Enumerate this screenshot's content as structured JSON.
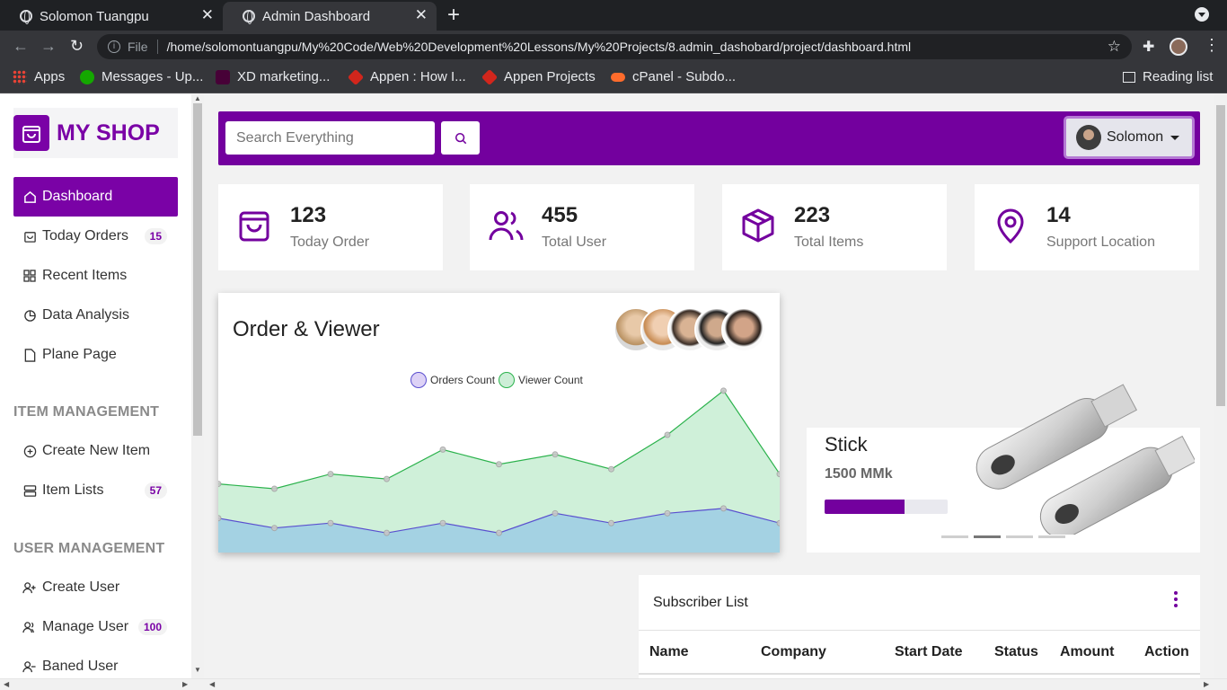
{
  "browser": {
    "tabs": [
      {
        "title": "Solomon Tuangpu"
      },
      {
        "title": "Admin Dashboard"
      }
    ],
    "address": {
      "scheme_label": "File",
      "url": "/home/solomontuangpu/My%20Code/Web%20Development%20Lessons/My%20Projects/8.admin_dashobard/project/dashboard.html"
    },
    "bookmarks": [
      {
        "label": "Apps"
      },
      {
        "label": "Messages - Up..."
      },
      {
        "label": "XD marketing..."
      },
      {
        "label": "Appen : How I..."
      },
      {
        "label": "Appen Projects"
      },
      {
        "label": "cPanel - Subdo..."
      }
    ],
    "reading_list": "Reading list"
  },
  "sidebar": {
    "brand": "MY SHOP",
    "items": [
      {
        "label": "Dashboard",
        "icon": "home-icon"
      },
      {
        "label": "Today Orders",
        "icon": "bag-icon",
        "badge": "15"
      },
      {
        "label": "Recent Items",
        "icon": "grid-icon"
      },
      {
        "label": "Data Analysis",
        "icon": "pie-icon"
      },
      {
        "label": "Plane Page",
        "icon": "file-icon"
      }
    ],
    "item_section": "ITEM MANAGEMENT",
    "item_items": [
      {
        "label": "Create New Item",
        "icon": "plus-circle-icon"
      },
      {
        "label": "Item Lists",
        "icon": "list-icon",
        "badge": "57"
      }
    ],
    "user_section": "USER MANAGEMENT",
    "user_items": [
      {
        "label": "Create User",
        "icon": "user-plus-icon"
      },
      {
        "label": "Manage User",
        "icon": "users-icon",
        "badge": "100"
      },
      {
        "label": "Baned User",
        "icon": "user-minus-icon"
      }
    ]
  },
  "header": {
    "search_placeholder": "Search Everything",
    "user_name": "Solomon"
  },
  "stats": [
    {
      "value": "123",
      "label": "Today Order",
      "icon": "bag-icon"
    },
    {
      "value": "455",
      "label": "Total User",
      "icon": "users-icon"
    },
    {
      "value": "223",
      "label": "Total Items",
      "icon": "box-icon"
    },
    {
      "value": "14",
      "label": "Support Location",
      "icon": "map-pin-icon"
    }
  ],
  "chart_card": {
    "title": "Order & Viewer"
  },
  "chart_data": {
    "type": "area",
    "x": [
      0,
      1,
      2,
      3,
      4,
      5,
      6,
      7,
      8,
      9,
      10
    ],
    "series": [
      {
        "name": "Orders Count",
        "values": [
          7,
          5,
          6,
          4,
          6,
          4,
          8,
          6,
          8,
          9,
          6
        ],
        "color": "#5a4fcf"
      },
      {
        "name": "Viewer Count",
        "values": [
          14,
          13,
          16,
          15,
          21,
          18,
          20,
          17,
          24,
          33,
          16
        ],
        "color": "#2bb24c"
      }
    ],
    "ylim": [
      0,
      40
    ],
    "grid": false,
    "legend": "top-center"
  },
  "product": {
    "name": "Stick",
    "price": "1500 MMk",
    "progress": 0.65,
    "slides": 4,
    "active_slide": 1
  },
  "subscribers": {
    "title": "Subscriber List",
    "columns": [
      "Name",
      "Company",
      "Start Date",
      "Status",
      "Amount",
      "Action"
    ]
  }
}
